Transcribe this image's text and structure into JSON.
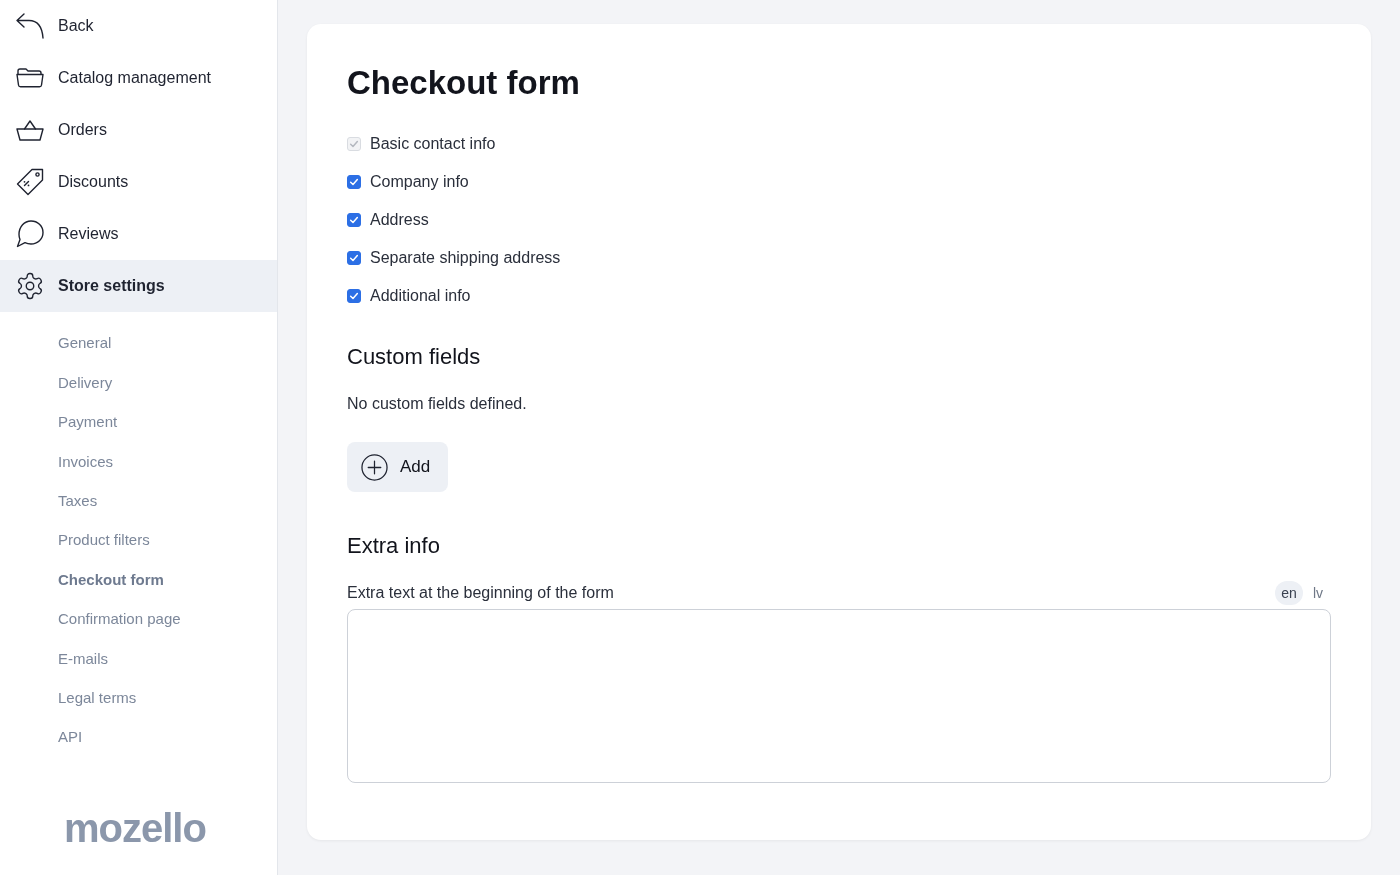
{
  "sidebar": {
    "back_link": "Back",
    "items": [
      {
        "label": "Catalog management",
        "selected": false
      },
      {
        "label": "Orders",
        "selected": false
      },
      {
        "label": "Discounts",
        "selected": false
      },
      {
        "label": "Reviews",
        "selected": false
      },
      {
        "label": "Store settings",
        "selected": true
      }
    ],
    "subitems": [
      {
        "label": "General",
        "selected": false
      },
      {
        "label": "Delivery",
        "selected": false
      },
      {
        "label": "Payment",
        "selected": false
      },
      {
        "label": "Invoices",
        "selected": false
      },
      {
        "label": "Taxes",
        "selected": false
      },
      {
        "label": "Product filters",
        "selected": false
      },
      {
        "label": "Checkout form",
        "selected": true
      },
      {
        "label": "Confirmation page",
        "selected": false
      },
      {
        "label": "E-mails",
        "selected": false
      },
      {
        "label": "Legal terms",
        "selected": false
      },
      {
        "label": "API",
        "selected": false
      }
    ],
    "logo": "mozello"
  },
  "form": {
    "title": "Checkout form",
    "checkboxes": [
      {
        "label": "Basic contact info",
        "checked": true,
        "disabled": true
      },
      {
        "label": "Company info",
        "checked": true,
        "disabled": false
      },
      {
        "label": "Address",
        "checked": true,
        "disabled": false
      },
      {
        "label": "Separate shipping address",
        "checked": true,
        "disabled": false
      },
      {
        "label": "Additional info",
        "checked": true,
        "disabled": false
      }
    ],
    "custom_fields": {
      "heading": "Custom fields",
      "empty_text": "No custom fields defined.",
      "add_button": "Add"
    },
    "extra_info": {
      "heading": "Extra info",
      "field_label": "Extra text at the beginning of the form",
      "languages": [
        {
          "label": "en",
          "selected": true
        },
        {
          "label": "lv",
          "selected": false
        }
      ]
    }
  }
}
